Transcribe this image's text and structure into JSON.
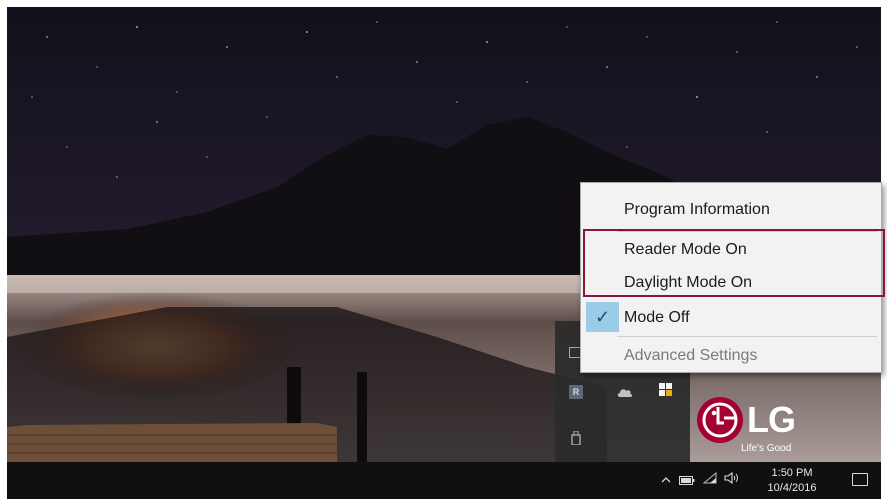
{
  "context_menu": {
    "items": [
      {
        "label": "Program Information",
        "checked": false,
        "enabled": true
      },
      {
        "label": "Reader Mode On",
        "checked": false,
        "enabled": true
      },
      {
        "label": "Daylight Mode On",
        "checked": false,
        "enabled": true
      },
      {
        "label": "Mode Off",
        "checked": true,
        "enabled": true
      },
      {
        "label": "Advanced Settings",
        "checked": false,
        "enabled": false
      }
    ],
    "check_glyph": "✓",
    "highlight_color": "#8b1538",
    "check_bg_color": "#9ccbe8"
  },
  "tray_overflow": {
    "icons": [
      "monitor-icon",
      "reader-app-icon",
      "onedrive-cloud-icon",
      "security-shield-icon",
      "usb-drive-icon"
    ],
    "reader_letter": "R"
  },
  "wallpaper": {
    "brand": "LG",
    "tagline": "Life's Good",
    "brand_color": "#a50034"
  },
  "taskbar": {
    "time": "1:50 PM",
    "date": "10/4/2016",
    "icons": [
      "chevron-up-icon",
      "battery-icon",
      "wifi-icon",
      "volume-icon",
      "action-center-icon"
    ]
  }
}
